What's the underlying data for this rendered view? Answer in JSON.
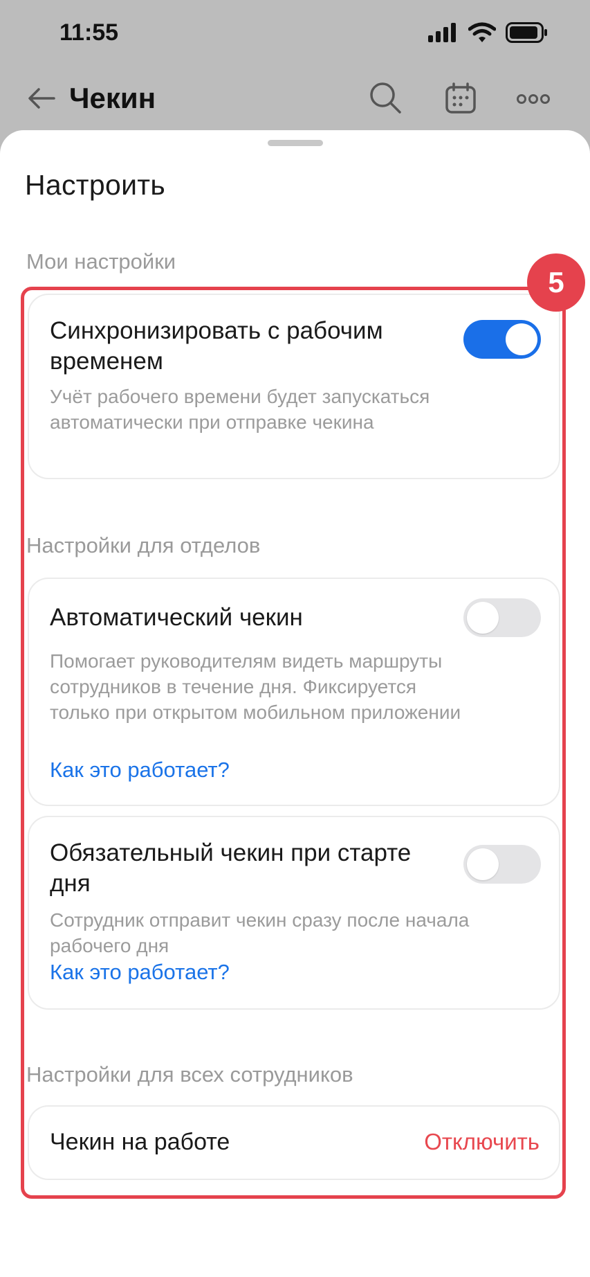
{
  "status_bar": {
    "time": "11:55"
  },
  "header": {
    "title": "Чекин",
    "icons": [
      "back-arrow-icon",
      "search-icon",
      "calendar-icon",
      "more-icon"
    ]
  },
  "sheet": {
    "title": "Настроить",
    "my_settings": {
      "label": "Мои настройки",
      "sync": {
        "title": "Синхронизировать с рабочим временем",
        "description": "Учёт рабочего времени будет запускаться автоматически при отправке чекина",
        "enabled": true
      }
    },
    "department_settings": {
      "label": "Настройки для отделов",
      "auto_checkin": {
        "title": "Автоматический чекин",
        "description": "Помогает руководителям видеть маршруты сотрудников в течение дня. Фиксируется только при открытом мобильном приложении",
        "link": "Как это работает?",
        "enabled": false
      },
      "required_checkin": {
        "title": "Обязательный чекин при старте дня",
        "description": "Сотрудник отправит чекин сразу после начала рабочего дня",
        "link": "Как это работает?",
        "enabled": false
      }
    },
    "all_employees_settings": {
      "label": "Настройки для всех сотрудников",
      "checkin_at_work": {
        "label": "Чекин на работе",
        "action": "Отключить"
      }
    }
  },
  "annotation": {
    "step": "5",
    "color": "#e5424d"
  },
  "colors": {
    "accent": "#1a6fe8",
    "link": "#1a73e8",
    "danger": "#e8484f"
  }
}
